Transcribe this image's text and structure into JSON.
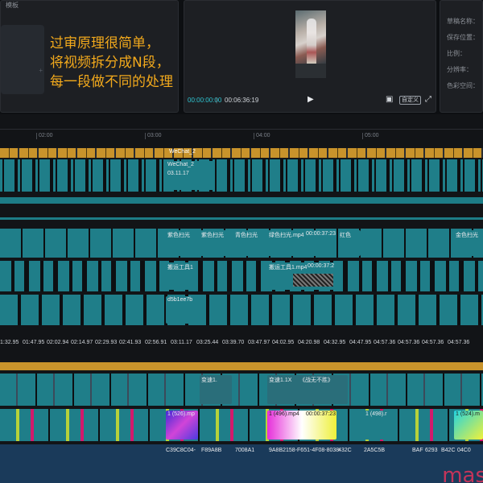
{
  "left_panel": {
    "title": "模板",
    "overlay_lines": [
      "过审原理很简单，",
      "将视频拆分成N段，",
      "每一段做不同的处理"
    ]
  },
  "preview": {
    "current_time": "00:00:00:00",
    "separator": "|",
    "total_time": "00:06:36:19",
    "ratio_label": "自定义",
    "icons": {
      "play": "play-icon",
      "fit": "fit-screen-icon",
      "fullscreen": "fullscreen-icon"
    }
  },
  "properties": {
    "labels": [
      "草稿名称：",
      "保存位置：",
      "比例：",
      "分辨率：",
      "色彩空间："
    ]
  },
  "ruler": {
    "ticks": [
      "02:00",
      "03:00",
      "04:00",
      "05:00"
    ]
  },
  "tracks": {
    "wechat_label": "WeChat_2",
    "wechat_sub": "03.11.17",
    "purple_label": "紫色扫光",
    "purple_label_2": "紫色扫光",
    "blue_label": "青色扫光",
    "green_label": "绿色扫光.mp4",
    "green_time": "00:00:37:23",
    "red_label": "红色",
    "gold_label": "金色扫光",
    "move_label": "搬运工具1",
    "move_label_2": "搬运工具1.mp4",
    "move_time": "00:00:37:2",
    "d5b_label": "d5b1ee7b",
    "speed_label": "变速1.",
    "speed_label_2": "变速1.1X",
    "speed_label_3": "《战无不胜》",
    "mp4_label": "1 (526).mp",
    "mp4_label_2": "1 (496).mp4",
    "mp4_time": "00:00:37:23",
    "mp4_label_3": "1 (498).r",
    "mp4_label_4": "1 (524).m",
    "hash_1": "C39C8C04-",
    "hash_2": "F89A8B",
    "hash_3": "7008A1",
    "hash_4": "9A8B2158-F651-4F08-8038-",
    "hash_5": "432C",
    "hash_6": "2A5C5B",
    "hash_7": "BAF",
    "hash_8": "6293",
    "hash_9": "B42C",
    "hash_10": "04C0"
  },
  "timestamps": [
    "1:32.95",
    "01:47.95",
    "02:02.94",
    "02:14.97",
    "02:29.93",
    "02:41.93",
    "02:56.91",
    "03:11.17",
    "03:25.44",
    "03:39.70",
    "03:47.97",
    "04:02.95",
    "04:20.98",
    "04:32.95",
    "04:47.95",
    "04:57.36",
    "04:57.36",
    "04:57.36",
    "04:57.36"
  ],
  "watermark": "mas",
  "colors": {
    "accent": "#2fc6d3",
    "gold": "#c8932b",
    "teal": "#1d7c86",
    "overlay_text": "#f2a91c"
  }
}
